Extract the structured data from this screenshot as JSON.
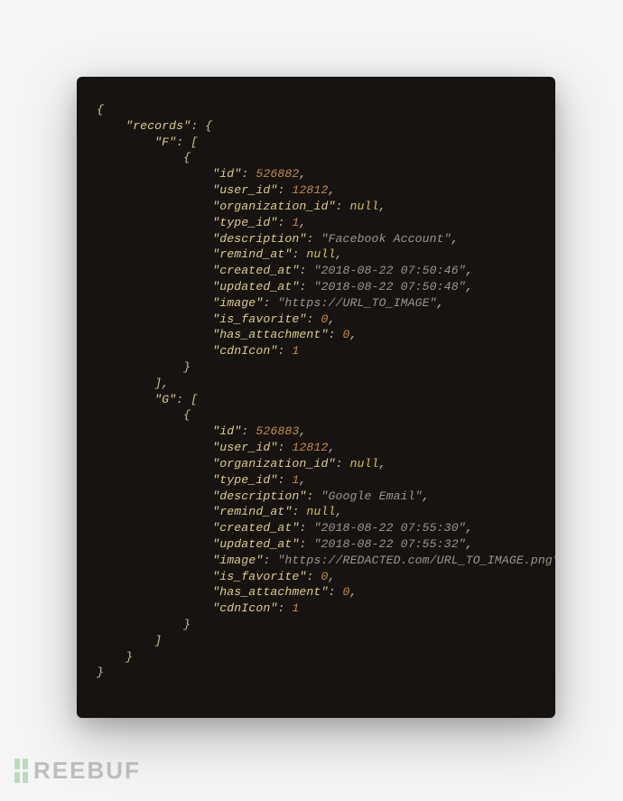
{
  "watermark": {
    "text": "REEBUF"
  },
  "indent": "    ",
  "json": {
    "records": {
      "F": [
        {
          "id": 526882,
          "user_id": 12812,
          "organization_id": null,
          "type_id": 1,
          "description": "Facebook Account",
          "remind_at": null,
          "created_at": "2018-08-22 07:50:46",
          "updated_at": "2018-08-22 07:50:48",
          "image": "https://URL_TO_IMAGE",
          "is_favorite": 0,
          "has_attachment": 0,
          "cdnIcon": 1
        }
      ],
      "G": [
        {
          "id": 526883,
          "user_id": 12812,
          "organization_id": null,
          "type_id": 1,
          "description": "Google Email",
          "remind_at": null,
          "created_at": "2018-08-22 07:55:30",
          "updated_at": "2018-08-22 07:55:32",
          "image": "https://REDACTED.com/URL_TO_IMAGE.png",
          "is_favorite": 0,
          "has_attachment": 0,
          "cdnIcon": 1
        }
      ]
    }
  }
}
